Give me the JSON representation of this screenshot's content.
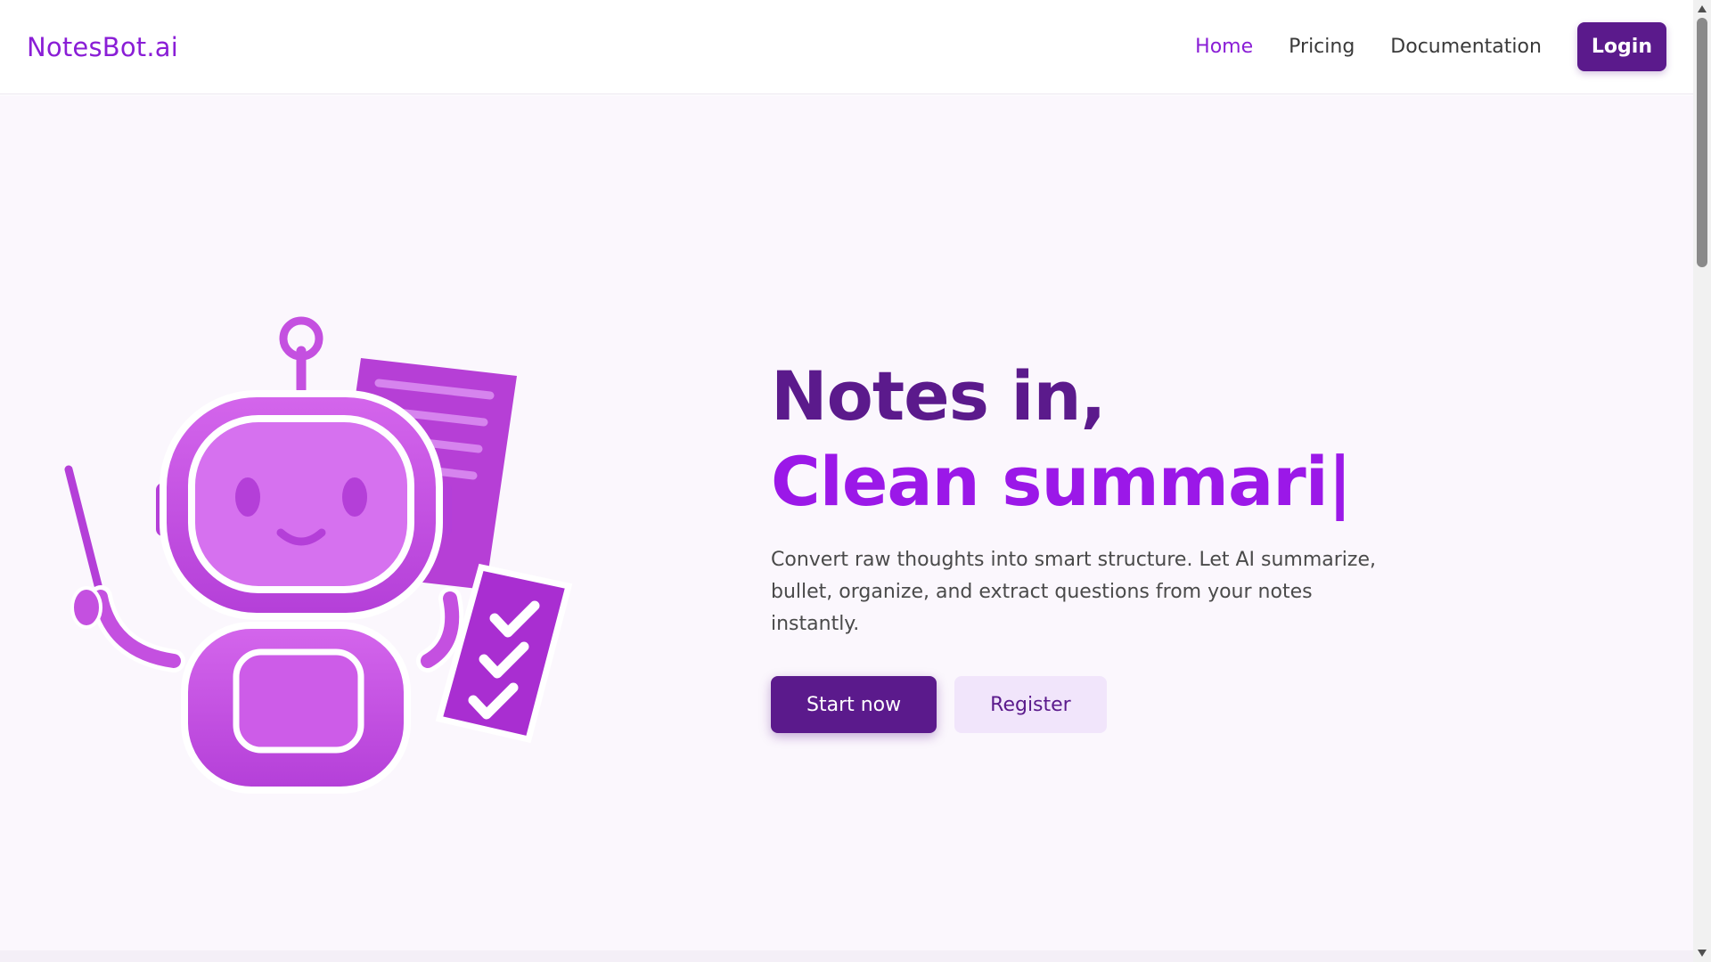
{
  "brand": {
    "name": "NotesBot.ai"
  },
  "nav": {
    "items": [
      {
        "label": "Home",
        "active": true
      },
      {
        "label": "Pricing",
        "active": false
      },
      {
        "label": "Documentation",
        "active": false
      }
    ],
    "login_label": "Login"
  },
  "hero": {
    "line1": "Notes in,",
    "line2_typed": "Clean summari",
    "cursor": "|",
    "subtitle": "Convert raw thoughts into smart structure. Let AI summarize, bullet, organize, and extract questions from your notes instantly.",
    "start_label": "Start now",
    "register_label": "Register",
    "illustration": "robot-with-notes-and-checklist-icon"
  },
  "colors": {
    "brand": "#8a1ed6",
    "primary_dark": "#5b1a8c",
    "accent": "#9b18e8",
    "robot": "#c450e0",
    "hero_bg": "#fbf7fd"
  }
}
